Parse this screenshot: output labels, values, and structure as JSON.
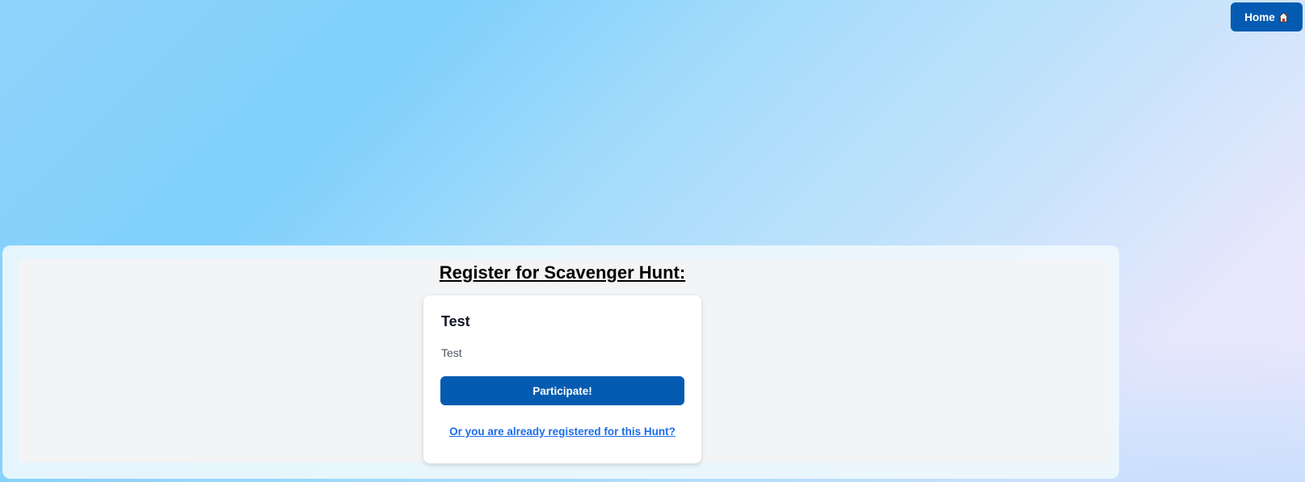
{
  "header": {
    "home_label": "Home",
    "home_icon": "house-icon"
  },
  "main": {
    "title": "Register for Scavenger Hunt:",
    "hunt": {
      "name": "Test",
      "description": "Test",
      "participate_label": "Participate!",
      "registered_link_label": "Or you are already registered for this Hunt?"
    }
  },
  "colors": {
    "primary_button": "#055bb1",
    "link": "#1d6ee8",
    "panel_bg": "#f3f4f6",
    "card_bg": "#ffffff"
  }
}
